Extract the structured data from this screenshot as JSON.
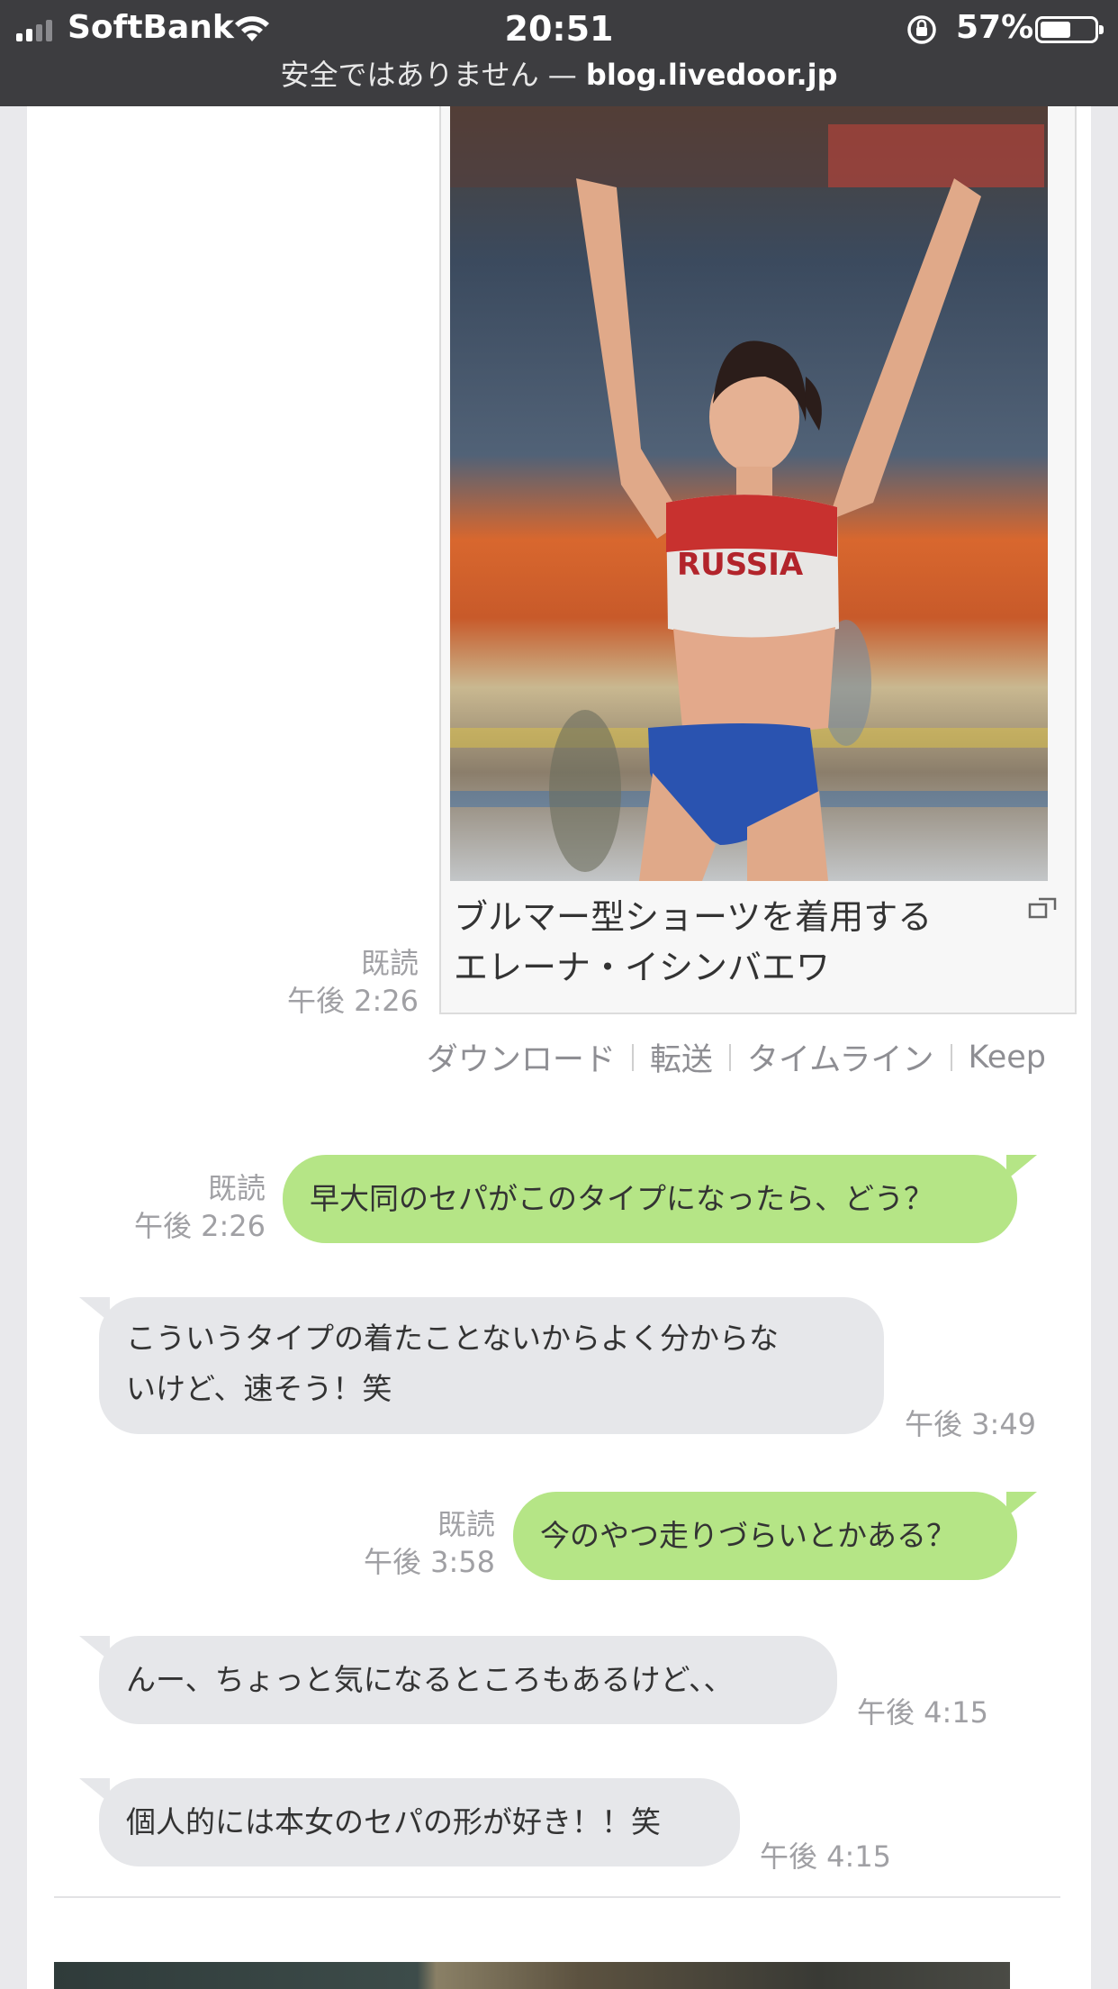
{
  "status_bar": {
    "carrier": "SoftBank",
    "time": "20:51",
    "battery_pct": "57%",
    "battery_level": 0.57,
    "signal_bars": 2
  },
  "browser": {
    "security_text": "安全ではありません —",
    "domain": "blog.livedoor.jp"
  },
  "image_message": {
    "caption_line1": "ブルマー型ショーツを着用する",
    "caption_line2": "エレーナ・イシンバエワ",
    "read_label": "既読",
    "time": "午後 2:26",
    "photo_text": "RUSSIA"
  },
  "actions": {
    "download": "ダウンロード",
    "forward": "転送",
    "timeline": "タイムライン",
    "keep": "Keep"
  },
  "messages": [
    {
      "side": "sent",
      "text": "早大同のセパがこのタイプになったら、どう？",
      "read": "既読",
      "time": "午後 2:26"
    },
    {
      "side": "received",
      "line1": "こういうタイプの着たことないからよく分からな",
      "line2": "いけど、速そう！笑",
      "time": "午後 3:49"
    },
    {
      "side": "sent",
      "text": "今のやつ走りづらいとかある？",
      "read": "既読",
      "time": "午後 3:58"
    },
    {
      "side": "received",
      "text": "んー、ちょっと気になるところもあるけど、、",
      "time": "午後 4:15"
    },
    {
      "side": "received",
      "text": "個人的には本女のセパの形が好き！！笑",
      "time": "午後 4:15"
    }
  ],
  "colors": {
    "status_bar_bg": "#3d3d40",
    "sent_bubble": "#b5e586",
    "received_bubble": "#e6e7ea",
    "page_bg": "#e9e9ec"
  }
}
